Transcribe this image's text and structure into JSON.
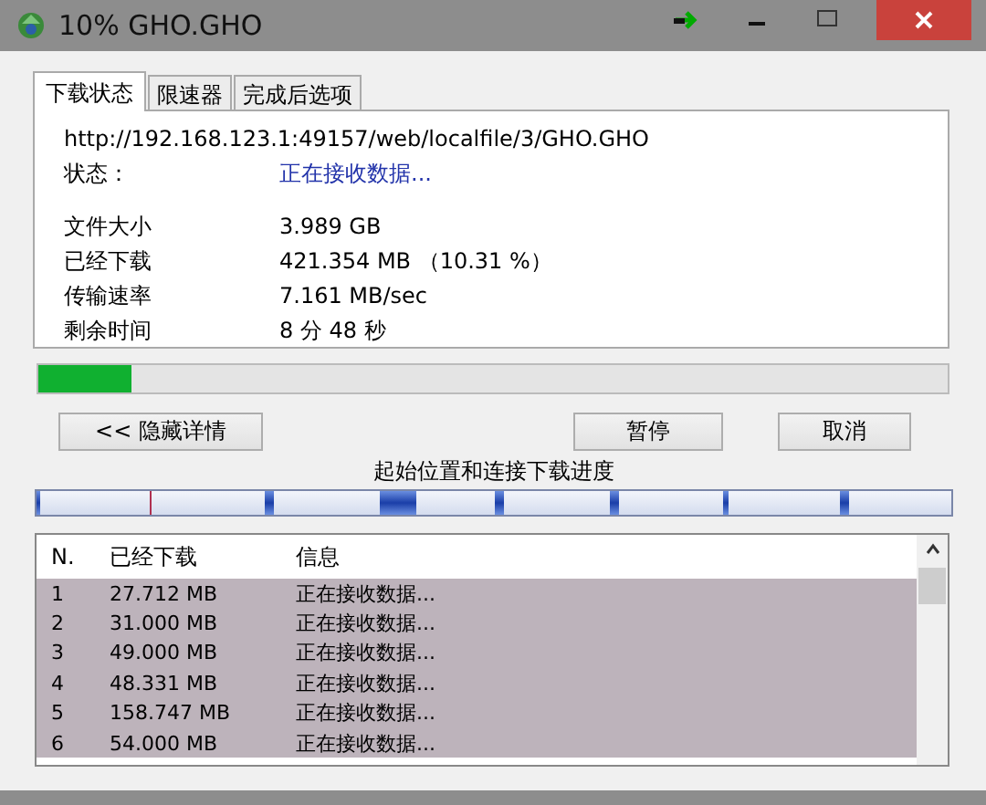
{
  "window": {
    "title": "10% GHO.GHO"
  },
  "tabs": [
    {
      "label": "下载状态",
      "selected": true
    },
    {
      "label": "限速器",
      "selected": false
    },
    {
      "label": "完成后选项",
      "selected": false
    }
  ],
  "status": {
    "url": "http://192.168.123.1:49157/web/localfile/3/GHO.GHO",
    "state_label": "状态：",
    "state_value": "正在接收数据...",
    "fields": [
      {
        "label": "文件大小",
        "value": "3.989  GB"
      },
      {
        "label": "已经下载",
        "value": "421.354  MB （10.31 %）"
      },
      {
        "label": "传输速率",
        "value": "7.161  MB/sec"
      },
      {
        "label": "剩余时间",
        "value": "8 分 48 秒"
      }
    ]
  },
  "progress": {
    "level": 0.103
  },
  "buttons": {
    "details": "<< 隐藏详情",
    "pause": "暂停",
    "cancel": "取消"
  },
  "segments_title": "起始位置和连接下载进度",
  "connections": {
    "columns": [
      "N.",
      "已经下载",
      "信息"
    ],
    "rows": [
      [
        "1",
        "27.712 MB",
        "正在接收数据..."
      ],
      [
        "2",
        "31.000 MB",
        "正在接收数据..."
      ],
      [
        "3",
        "49.000 MB",
        "正在接收数据..."
      ],
      [
        "4",
        "48.331 MB",
        "正在接收数据..."
      ],
      [
        "5",
        "158.747 MB",
        "正在接收数据..."
      ],
      [
        "6",
        "54.000 MB",
        "正在接收数据..."
      ]
    ]
  }
}
